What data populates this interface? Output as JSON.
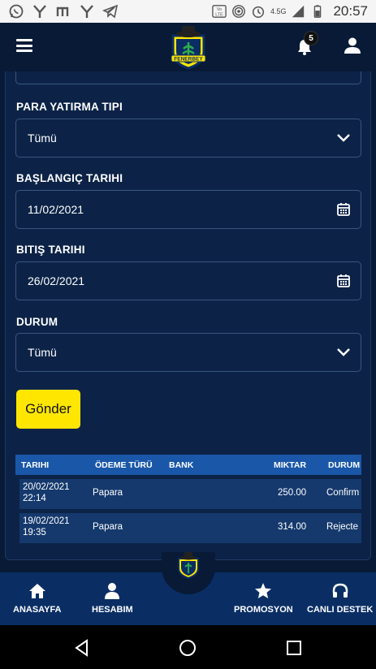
{
  "status_bar": {
    "time": "20:57",
    "network_label": "4.5G",
    "left_icons": [
      "whatsapp-icon",
      "y-app-icon",
      "m-app-icon",
      "y-app-icon",
      "telegram-icon"
    ],
    "right_icons": [
      "volte-icon",
      "hotspot-icon",
      "alarm-icon",
      "signal-icon",
      "battery-icon"
    ]
  },
  "header": {
    "logo_text": "FENERBEY",
    "notification_count": "5"
  },
  "form": {
    "deposit_type_label": "PARA YATIRMA TIPI",
    "deposit_type_value": "Tümü",
    "start_date_label": "BAŞLANGIÇ TARIHI",
    "start_date_value": "11/02/2021",
    "end_date_label": "BITIŞ TARIHI",
    "end_date_value": "26/02/2021",
    "status_label": "DURUM",
    "status_value": "Tümü",
    "submit_label": "Gönder"
  },
  "table": {
    "headers": [
      "TARIHI",
      "ÖDEME TÜRÜ",
      "BANK",
      "MIKTAR",
      "DURUM"
    ],
    "rows": [
      {
        "date": "20/02/2021",
        "time": "22:14",
        "method": "Papara",
        "bank": "",
        "amount": "250.00",
        "status": "Confirm"
      },
      {
        "date": "19/02/2021",
        "time": "19:35",
        "method": "Papara",
        "bank": "",
        "amount": "314.00",
        "status": "Rejecte"
      }
    ]
  },
  "bottom_nav": {
    "items": [
      {
        "label": "ANASAYFA",
        "icon": "home-icon"
      },
      {
        "label": "HESABIM",
        "icon": "user-icon"
      },
      {
        "label": "PROMOSYON",
        "icon": "star-icon"
      },
      {
        "label": "CANLI DESTEK",
        "icon": "headset-icon"
      }
    ]
  },
  "colors": {
    "background": "#081a36",
    "card": "#0c2347",
    "accent": "#ffe600",
    "table_header": "#1a57a8",
    "table_row": "#15396d"
  }
}
